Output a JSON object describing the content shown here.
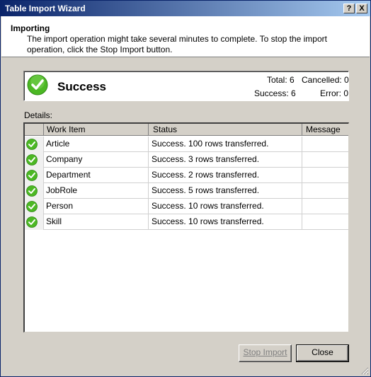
{
  "window": {
    "title": "Table Import Wizard",
    "help_button": "?",
    "close_button": "X"
  },
  "header": {
    "title": "Importing",
    "description": "The import operation might take several minutes to complete. To stop the import operation, click the Stop Import button."
  },
  "status": {
    "icon": "success-check-icon",
    "label": "Success",
    "total": "Total: 6",
    "cancelled": "Cancelled: 0",
    "success": "Success: 6",
    "error": "Error: 0"
  },
  "details": {
    "label": "Details:",
    "columns": [
      "Work Item",
      "Status",
      "Message"
    ],
    "rows": [
      {
        "item": "Article",
        "status": "Success. 100 rows transferred.",
        "message": ""
      },
      {
        "item": "Company",
        "status": "Success. 3 rows transferred.",
        "message": ""
      },
      {
        "item": "Department",
        "status": "Success. 2 rows transferred.",
        "message": ""
      },
      {
        "item": "JobRole",
        "status": "Success. 5 rows transferred.",
        "message": ""
      },
      {
        "item": "Person",
        "status": "Success. 10 rows transferred.",
        "message": ""
      },
      {
        "item": "Skill",
        "status": "Success. 10 rows transferred.",
        "message": ""
      }
    ]
  },
  "buttons": {
    "stop_import": "Stop Import",
    "close": "Close"
  },
  "colors": {
    "success_green": "#4cb824",
    "title_bar": "#0a246a",
    "dialog_bg": "#d4d0c8"
  }
}
